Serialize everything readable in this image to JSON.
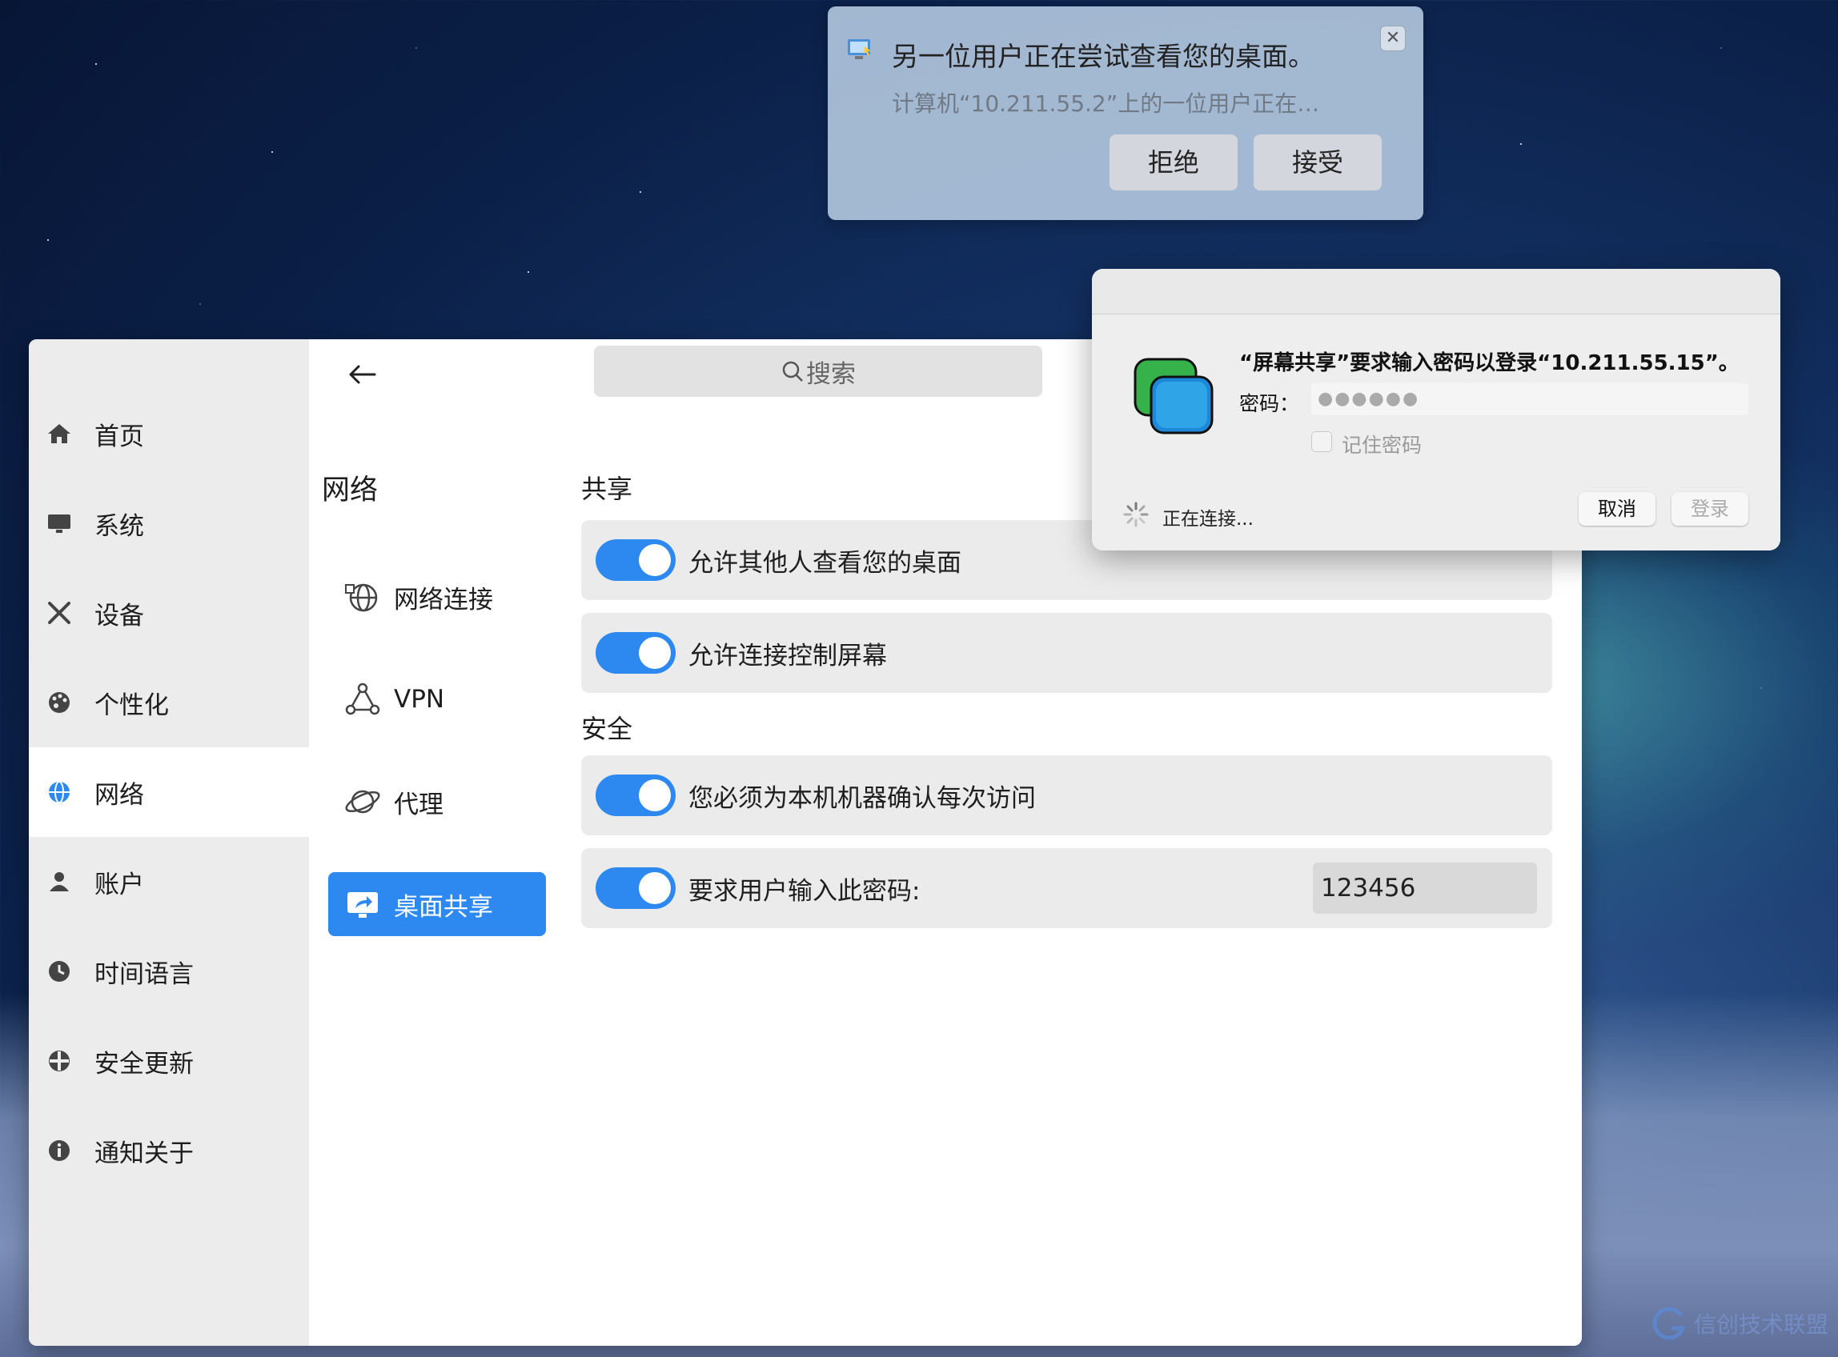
{
  "notification": {
    "title": "另一位用户正在尝试查看您的桌面。",
    "body": "计算机“10.211.55.2”上的一位用户正在…",
    "close": "✕",
    "reject_label": "拒绝",
    "accept_label": "接受"
  },
  "search": {
    "placeholder": "搜索"
  },
  "sidebar": {
    "items": [
      {
        "label": "首页",
        "icon": "home-icon"
      },
      {
        "label": "系统",
        "icon": "monitor-icon"
      },
      {
        "label": "设备",
        "icon": "tools-icon"
      },
      {
        "label": "个性化",
        "icon": "palette-icon"
      },
      {
        "label": "网络",
        "icon": "globe-icon",
        "active": true
      },
      {
        "label": "账户",
        "icon": "user-icon"
      },
      {
        "label": "时间语言",
        "icon": "clock-icon"
      },
      {
        "label": "安全更新",
        "icon": "shield-icon"
      },
      {
        "label": "通知关于",
        "icon": "info-icon"
      }
    ]
  },
  "network_nav": {
    "title": "网络",
    "items": [
      {
        "label": "网络连接",
        "icon": "network-connection-icon"
      },
      {
        "label": "VPN",
        "icon": "vpn-icon"
      },
      {
        "label": "代理",
        "icon": "proxy-icon"
      },
      {
        "label": "桌面共享",
        "icon": "desktop-share-icon",
        "active": true
      }
    ]
  },
  "content": {
    "share_title": "共享",
    "security_title": "安全",
    "rows": [
      {
        "label": "允许其他人查看您的桌面",
        "enabled": true
      },
      {
        "label": "允许连接控制屏幕",
        "enabled": true
      },
      {
        "label": "您必须为本机机器确认每次访问",
        "enabled": true
      },
      {
        "label": "要求用户输入此密码:",
        "enabled": true,
        "value": "123456"
      }
    ]
  },
  "dialog": {
    "title": "“屏幕共享”要求输入密码以登录“10.211.55.15”。",
    "password_label": "密码：",
    "password_value": "●●●●●●",
    "remember_label": "记住密码",
    "status": "正在连接...",
    "cancel_label": "取消",
    "login_label": "登录"
  },
  "watermark": {
    "text": "信创技术联盟"
  },
  "colors": {
    "accent": "#2d89ef",
    "sidebar_bg": "#ececec",
    "row_bg": "#ebebeb"
  }
}
